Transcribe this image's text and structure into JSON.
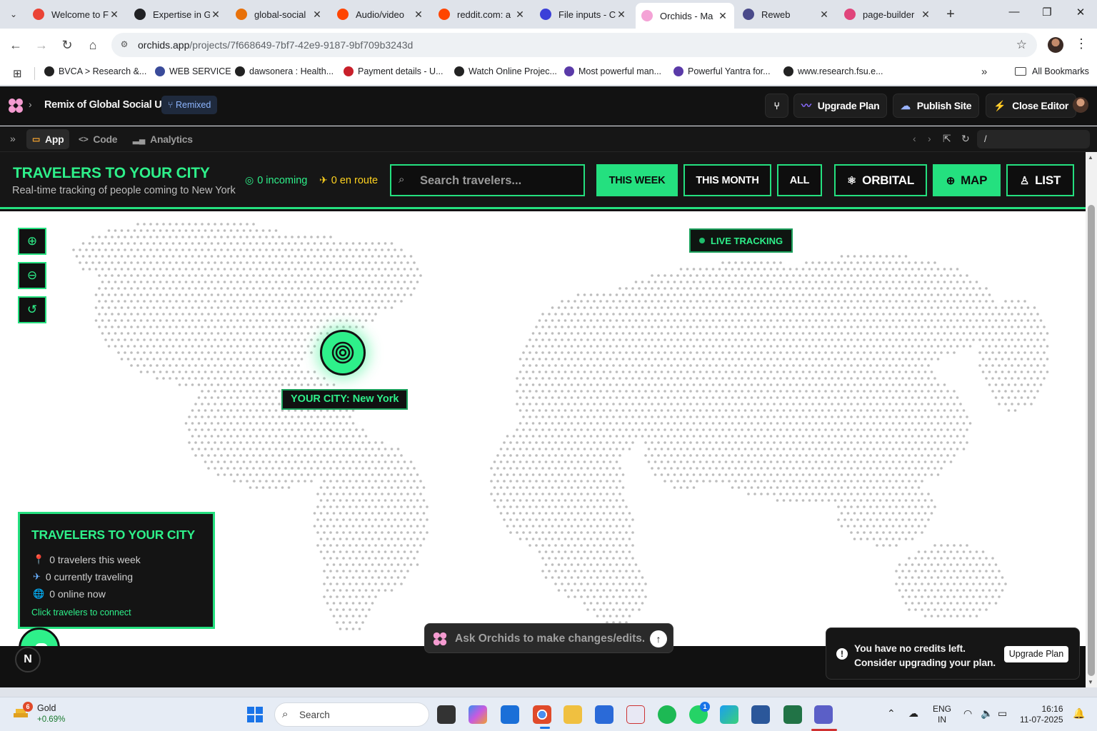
{
  "browser": {
    "tabs": [
      {
        "title": "Welcome to F",
        "favicon_color": "#ea4335"
      },
      {
        "title": "Expertise in G",
        "favicon_color": "#202124"
      },
      {
        "title": "global-social",
        "favicon_color": "#e8710a"
      },
      {
        "title": "Audio/video",
        "favicon_color": "#ff4500"
      },
      {
        "title": "reddit.com: a",
        "favicon_color": "#ff4500"
      },
      {
        "title": "File inputs - C",
        "favicon_color": "#3b3fd8"
      },
      {
        "title": "Orchids - Ma",
        "favicon_color": "#f4a3d6",
        "active": true
      },
      {
        "title": "Reweb",
        "favicon_color": "#4a4a8a"
      },
      {
        "title": "page-builder",
        "favicon_color": "#e0457b"
      }
    ],
    "url_host": "orchids.app",
    "url_path": "/projects/7f668649-7bf7-42e9-9187-9bf709b3243d",
    "bookmarks": [
      {
        "label": "BVCA > Research &...",
        "color": "#222"
      },
      {
        "label": "WEB SERVICE",
        "color": "#3a4b9a"
      },
      {
        "label": "dawsonera : Health...",
        "color": "#222"
      },
      {
        "label": "Payment details - U...",
        "color": "#c8202a"
      },
      {
        "label": "Watch Online Projec...",
        "color": "#222"
      },
      {
        "label": "Most powerful man...",
        "color": "#5a3aa8"
      },
      {
        "label": "Powerful Yantra for...",
        "color": "#5a3aa8"
      },
      {
        "label": "www.research.fsu.e...",
        "color": "#222"
      }
    ],
    "all_bookmarks": "All Bookmarks"
  },
  "editor": {
    "project_name": "Remix of Global Social UI",
    "remixed_badge": "Remixed",
    "upgrade_plan": "Upgrade Plan",
    "publish_site": "Publish Site",
    "close_editor": "Close Editor",
    "tabs": [
      "App",
      "Code",
      "Analytics"
    ],
    "path": "/"
  },
  "app": {
    "title": "TRAVELERS TO YOUR CITY",
    "subtitle": "Real-time tracking of people coming to New York",
    "incoming": "0 incoming",
    "en_route": "0 en route",
    "search_placeholder": "Search travelers...",
    "filters": [
      "THIS WEEK",
      "THIS MONTH",
      "ALL"
    ],
    "active_filter": "THIS WEEK",
    "views": [
      "ORBITAL",
      "MAP",
      "LIST"
    ],
    "active_view": "MAP",
    "accent_color": "#24e07f",
    "live_tracking": "LIVE TRACKING",
    "city_label": "YOUR CITY: New York",
    "card": {
      "title": "TRAVELERS TO YOUR CITY",
      "rows": [
        "0 travelers this week",
        "0 currently traveling",
        "0 online now"
      ],
      "cta": "Click travelers to connect"
    },
    "avatar_letter": "N"
  },
  "assistant": {
    "placeholder": "Ask Orchids to make changes/edits...",
    "toast_message": "You have no credits left. Consider upgrading your plan.",
    "toast_button": "Upgrade Plan"
  },
  "taskbar": {
    "weather_name": "Gold",
    "weather_change": "+0.69%",
    "weather_badge": "6",
    "search_label": "Search",
    "whatsapp_badge": "1",
    "lang_top": "ENG",
    "lang_bottom": "IN",
    "time": "16:16",
    "date": "11-07-2025"
  }
}
